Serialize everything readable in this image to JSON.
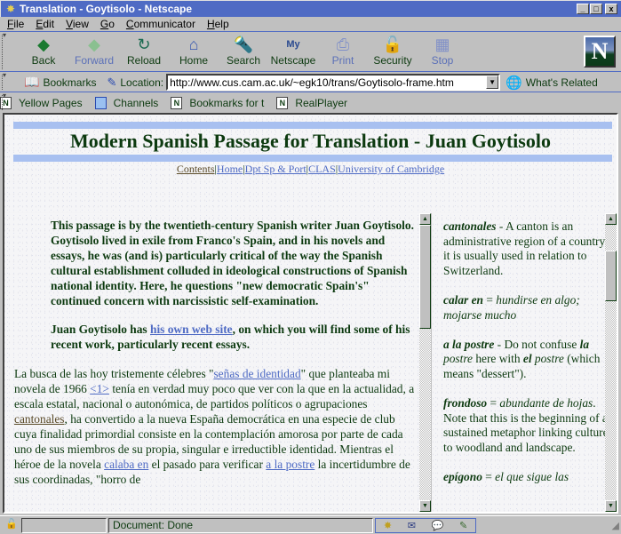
{
  "window": {
    "title": "Translation - Goytisolo - Netscape",
    "controls": {
      "minimize": "_",
      "maximize": "□",
      "close": "x"
    }
  },
  "menu": [
    "File",
    "Edit",
    "View",
    "Go",
    "Communicator",
    "Help"
  ],
  "nav_toolbar": [
    {
      "label": "Back",
      "icon": "back-arrow-icon",
      "glyph": "◆",
      "color": "#1a7a30",
      "enabled": true
    },
    {
      "label": "Forward",
      "icon": "forward-arrow-icon",
      "glyph": "◆",
      "color": "#8ac090",
      "enabled": false
    },
    {
      "label": "Reload",
      "icon": "reload-icon",
      "glyph": "↻",
      "color": "#1a6a50",
      "enabled": true
    },
    {
      "label": "Home",
      "icon": "home-icon",
      "glyph": "⌂",
      "color": "#3a5ab0",
      "enabled": true
    },
    {
      "label": "Search",
      "icon": "search-icon",
      "glyph": "🔦",
      "color": "#3a5ab0",
      "enabled": true
    },
    {
      "label": "Netscape",
      "icon": "my-netscape-icon",
      "glyph": "My",
      "color": "#2a4a90",
      "enabled": true
    },
    {
      "label": "Print",
      "icon": "print-icon",
      "glyph": "⎙",
      "color": "#8090c8",
      "enabled": false
    },
    {
      "label": "Security",
      "icon": "security-lock-icon",
      "glyph": "🔓",
      "color": "#3a4a30",
      "enabled": true
    },
    {
      "label": "Stop",
      "icon": "stop-icon",
      "glyph": "▦",
      "color": "#8090c8",
      "enabled": false
    }
  ],
  "logo_letter": "N",
  "location_bar": {
    "bookmarks_label": "Bookmarks",
    "location_label": "Location:",
    "url": "http://www.cus.cam.ac.uk/~egk10/trans/Goytisolo-frame.htm",
    "whats_related_label": "What's Related"
  },
  "personal_toolbar": [
    "Yellow Pages",
    "Channels",
    "Bookmarks for t",
    "RealPlayer"
  ],
  "page": {
    "title": "Modern Spanish Passage for Translation - Juan Goytisolo",
    "nav_links": [
      {
        "label": "Contents",
        "visited": true
      },
      {
        "label": "Home",
        "visited": false
      },
      {
        "label": "Dpt Sp & Port",
        "visited": false
      },
      {
        "label": "CLAS",
        "visited": false
      },
      {
        "label": "University of Cambridge",
        "visited": false
      }
    ],
    "separator": "|",
    "intro": "This passage is by the twentieth-century Spanish writer Juan Goytisolo. Goytisolo lived in exile from Franco's Spain, and in his novels and essays, he was (and is) particularly critical of the way the Spanish cultural establishment colluded in ideological constructions of Spanish national identity. Here, he questions \"new democratic Spain's\" continued concern with narcissistic self-examination.",
    "website_note": {
      "before": "Juan Goytisolo has ",
      "link": "his own web site",
      "after": ", on which you will find some of his recent work, particularly recent essays."
    },
    "passage": {
      "t1": "La busca de las hoy tristemente célebres \"",
      "l1": "señas de identidad",
      "t2": "\" que planteaba mi novela de 1966 ",
      "l2": "<1>",
      "t3": " tenía en verdad muy poco que ver con la que en la actualidad, a escala estatal, nacional o autonómica, de partidos políticos o agrupaciones ",
      "l3": "cantonales",
      "t4": ", ha convertido a la nueva España democrática en una especie de club cuya finalidad primordial consiste en la contemplación amorosa por parte de cada uno de sus miembros de su propia, singular e irreductible identidad.  Mientras el héroe de la novela ",
      "l4": "calaba en",
      "t5": " el pasado para verificar ",
      "l5": "a la postre",
      "t6": " la incertidumbre de sus coordinadas, \"horro de"
    }
  },
  "glossary": [
    {
      "term": "cantonales",
      "sep": " - ",
      "definition": "A canton is an administrative region of a country; it is usually used in relation to Switzerland."
    },
    {
      "term": "calar en",
      "sep": " = ",
      "definition_italic": "hundirse en algo; mojarse mucho"
    },
    {
      "term": "a la postre",
      "sep": " - ",
      "d1": "Do not confuse ",
      "b1": "la",
      "i1": " postre",
      "d2": " here with ",
      "b2": "el",
      "i2": " postre",
      "d3": " (which means \"dessert\")."
    },
    {
      "term": "frondoso",
      "sep": " = ",
      "italic": "abundante de hojas",
      "rest": ". Note that this is the beginning of a sustained metaphor linking culture to woodland and landscape."
    },
    {
      "term": "epígono",
      "sep": " = ",
      "italic": "el que sigue las"
    }
  ],
  "status_bar": {
    "text": "Document: Done"
  },
  "colors": {
    "titlebar": "#4f6bc4",
    "text_green": "#0d3a10",
    "link": "#4f6bc4",
    "visited_link": "#5a4a28",
    "header_bar": "#a8c0f0"
  }
}
